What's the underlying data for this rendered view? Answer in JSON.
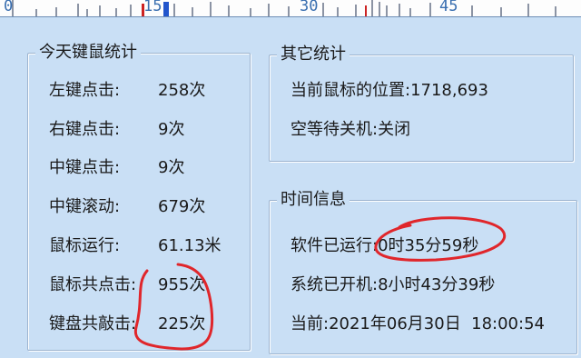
{
  "timeline": {
    "ticks": [
      "0",
      "15",
      "30",
      "45"
    ]
  },
  "keymouse_stats": {
    "title": "今天键鼠统计",
    "rows": [
      {
        "label": "左键点击:",
        "value": "258次"
      },
      {
        "label": "右键点击:",
        "value": "9次"
      },
      {
        "label": "中键点击:",
        "value": "9次"
      },
      {
        "label": "中键滚动:",
        "value": "679次"
      },
      {
        "label": "鼠标运行:",
        "value": "61.13米"
      },
      {
        "label": "鼠标共点击:",
        "value": "955次"
      },
      {
        "label": "键盘共敲击:",
        "value": "225次"
      }
    ]
  },
  "other_stats": {
    "title": "其它统计",
    "rows": [
      {
        "label": "当前鼠标的位置:",
        "value": "1718,693"
      },
      {
        "label": "空等待关机:",
        "value": "关闭"
      }
    ]
  },
  "time_info": {
    "title": "时间信息",
    "rows": [
      {
        "label": "软件已运行:",
        "value": "0时35分59秒"
      },
      {
        "label": "系统已开机:",
        "value": "8小时43分39秒"
      },
      {
        "label": "当前:",
        "value": "2021年06月30日  18:00:54"
      }
    ]
  },
  "colors": {
    "background": "#c9dff5",
    "annotation": "#e0262b",
    "tick_label": "#3a6fb0"
  }
}
